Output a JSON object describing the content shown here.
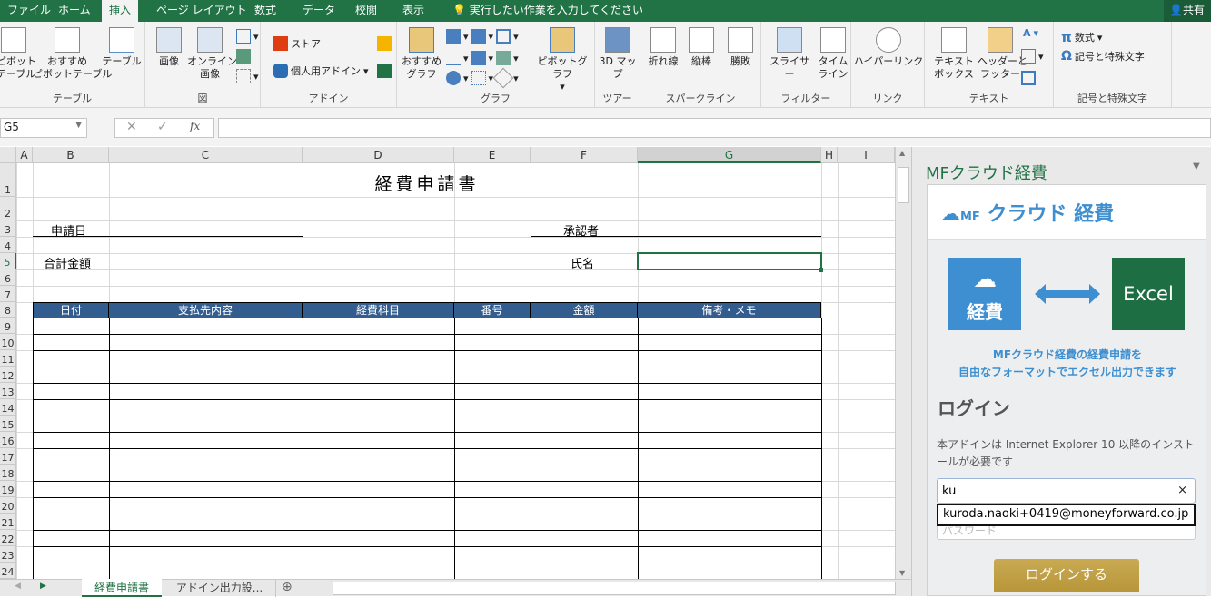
{
  "ribbon_tabs": [
    "ファイル",
    "ホーム",
    "挿入",
    "ページ レイアウト",
    "数式",
    "データ",
    "校閲",
    "表示"
  ],
  "active_tab": "挿入",
  "tell_me": "実行したい作業を入力してください",
  "share": "共有",
  "groups": {
    "table": {
      "label": "テーブル",
      "pivot": "ピボット\nテーブル",
      "recommended_pivot": "おすすめ\nピボットテーブル",
      "table": "テーブル"
    },
    "illustrations": {
      "label": "図",
      "picture": "画像",
      "online_picture": "オンライン\n画像"
    },
    "addins": {
      "label": "アドイン",
      "store": "ストア",
      "my_addins": "個人用アドイン"
    },
    "charts": {
      "label": "グラフ",
      "recommended": "おすすめ\nグラフ",
      "pivot_chart": "ピボットグラフ"
    },
    "tours": {
      "label": "ツアー",
      "map3d": "3D マッ\nプ"
    },
    "sparklines": {
      "label": "スパークライン",
      "line": "折れ線",
      "column": "縦棒",
      "winloss": "勝敗"
    },
    "filters": {
      "label": "フィルター",
      "slicer": "スライサー",
      "timeline": "タイム\nライン"
    },
    "links": {
      "label": "リンク",
      "hyperlink": "ハイパーリンク"
    },
    "text": {
      "label": "テキスト",
      "textbox": "テキスト\nボックス",
      "header_footer": "ヘッダーと\nフッター"
    },
    "symbols": {
      "label": "記号と特殊文字",
      "equation": "数式",
      "symbol": "記号と特殊文字"
    }
  },
  "name_box": "G5",
  "fx": "fx",
  "columns": [
    "A",
    "B",
    "C",
    "D",
    "E",
    "F",
    "G",
    "H",
    "I"
  ],
  "selected_cell": "G5",
  "sheet": {
    "title": "経費申請書",
    "apply_date": "申請日",
    "total": "合計金額",
    "approver": "承認者",
    "name": "氏名",
    "table_headers": [
      "日付",
      "支払先内容",
      "経費科目",
      "番号",
      "金額",
      "備考・メモ"
    ]
  },
  "sheet_tabs": [
    "経費申請書",
    "アドイン出力設... "
  ],
  "active_sheet": "経費申請書",
  "pane": {
    "title": "MFクラウド経費",
    "logo_text": "クラウド 経費",
    "logo_mf": "MF",
    "mf_tile": "経費",
    "excel_tile": "Excel",
    "tagline1": "MFクラウド経費の経費申請を",
    "tagline2": "自由なフォーマットでエクセル出力できます",
    "login_heading": "ログイン",
    "notice": "本アドインは Internet Explorer 10 以降のインストールが必要です",
    "email_value": "ku",
    "autocomplete": "kuroda.naoki+0419@moneyforward.co.jp",
    "password_placeholder": "パスワード",
    "login_button": "ログインする",
    "clear": "×"
  },
  "colors": {
    "excel_green": "#217346",
    "header_blue": "#335c8f",
    "mf_blue": "#3d8fd1",
    "login_gold": "#c4a24a"
  }
}
